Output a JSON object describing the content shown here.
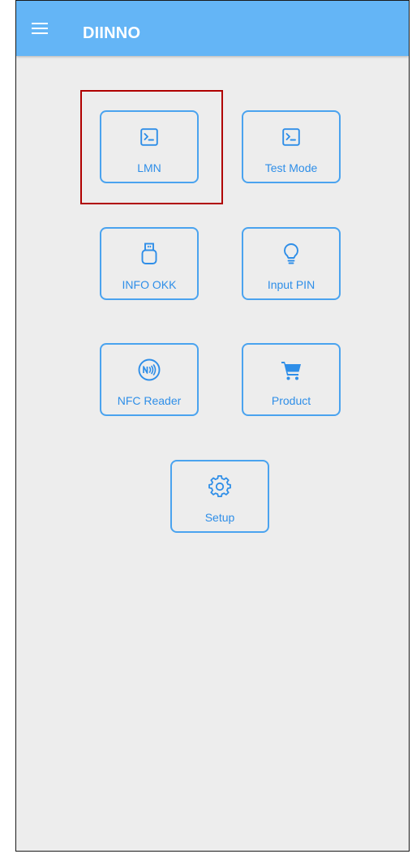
{
  "app_bar": {
    "title": "DIINNO",
    "menu_icon": "hamburger-menu-icon",
    "color": "#64b5f6"
  },
  "tiles": [
    {
      "id": "lmn",
      "label": "LMN",
      "icon": "terminal-icon"
    },
    {
      "id": "test_mode",
      "label": "Test Mode",
      "icon": "terminal-icon"
    },
    {
      "id": "info_okk",
      "label": "INFO OKK",
      "icon": "usb-drive-icon"
    },
    {
      "id": "input_pin",
      "label": "Input PIN",
      "icon": "lightbulb-icon"
    },
    {
      "id": "nfc_reader",
      "label": "NFC Reader",
      "icon": "nfc-icon"
    },
    {
      "id": "product",
      "label": "Product",
      "icon": "shopping-cart-icon"
    },
    {
      "id": "setup",
      "label": "Setup",
      "icon": "gear-icon"
    }
  ],
  "highlighted_tile": "lmn",
  "colors": {
    "accent": "#2e8ee8",
    "tile_border": "#4aa3ef",
    "background": "#ededed",
    "highlight_border": "#b00000"
  }
}
